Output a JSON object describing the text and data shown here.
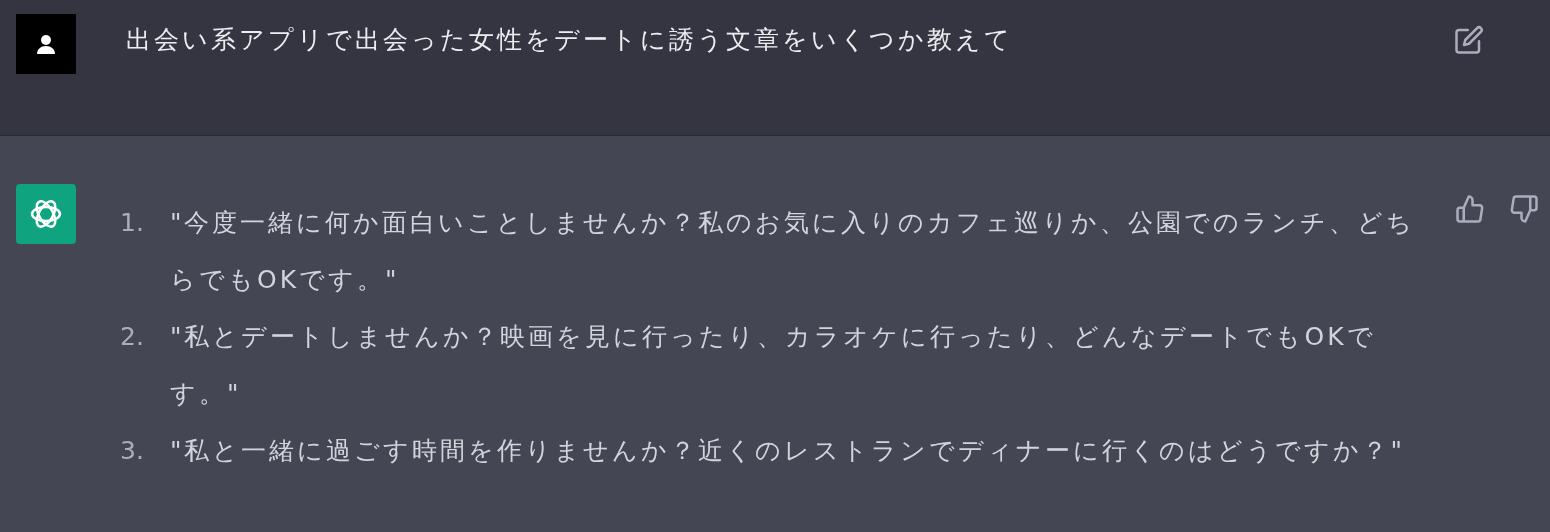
{
  "user_message": {
    "text": "出会い系アプリで出会った女性をデートに誘う文章をいくつか教えて"
  },
  "assistant_message": {
    "items": [
      {
        "number": "1.",
        "text": "\"今度一緒に何か面白いことしませんか？私のお気に入りのカフェ巡りか、公園でのランチ、どちらでもOKです。\""
      },
      {
        "number": "2.",
        "text": "\"私とデートしませんか？映画を見に行ったり、カラオケに行ったり、どんなデートでもOKです。\""
      },
      {
        "number": "3.",
        "text": "\"私と一緒に過ごす時間を作りませんか？近くのレストランでディナーに行くのはどうですか？\""
      }
    ]
  }
}
